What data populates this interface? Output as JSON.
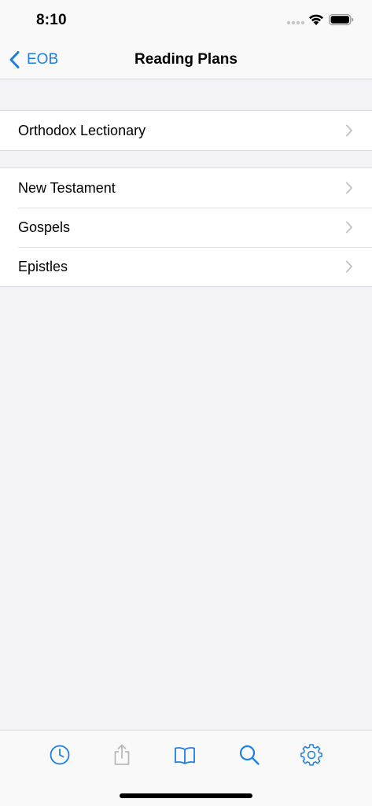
{
  "status_bar": {
    "time": "8:10"
  },
  "nav": {
    "back_label": "EOB",
    "title": "Reading Plans"
  },
  "sections": [
    {
      "rows": [
        {
          "label": "Orthodox Lectionary"
        }
      ]
    },
    {
      "rows": [
        {
          "label": "New Testament"
        },
        {
          "label": "Gospels"
        },
        {
          "label": "Epistles"
        }
      ]
    }
  ],
  "tab_bar": {
    "items": [
      {
        "icon": "clock-icon",
        "state": "enabled"
      },
      {
        "icon": "share-icon",
        "state": "disabled"
      },
      {
        "icon": "book-icon",
        "state": "enabled"
      },
      {
        "icon": "search-icon",
        "state": "enabled"
      },
      {
        "icon": "gear-icon",
        "state": "enabled"
      }
    ]
  },
  "colors": {
    "accent": "#1e7fe0",
    "disabled": "#b9b9bd",
    "background": "#f2f2f7",
    "chevron": "#c4c4c8"
  }
}
